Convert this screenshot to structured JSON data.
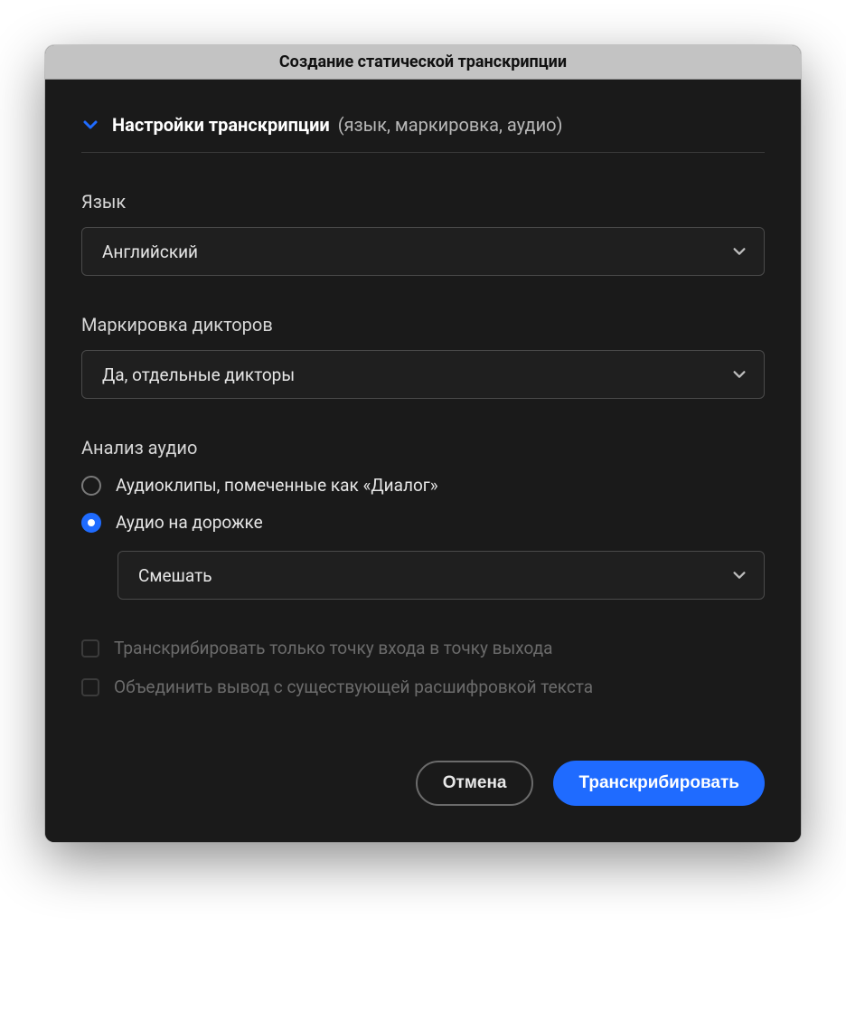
{
  "dialog": {
    "title": "Создание статической транскрипции",
    "section": {
      "title_bold": "Настройки транскрипции",
      "title_muted": "(язык, маркировка, аудио)"
    },
    "fields": {
      "language": {
        "label": "Язык",
        "value": "Английский"
      },
      "speaker_labeling": {
        "label": "Маркировка дикторов",
        "value": "Да, отдельные дикторы"
      },
      "audio_analysis": {
        "label": "Анализ аудио",
        "options": [
          {
            "label": "Аудиоклипы, помеченные как «Диалог»",
            "selected": false
          },
          {
            "label": "Аудио на дорожке",
            "selected": true
          }
        ],
        "track_select": {
          "value": "Смешать"
        }
      },
      "checkboxes": [
        {
          "label": "Транскрибировать только точку входа в точку выхода",
          "checked": false,
          "enabled": false
        },
        {
          "label": "Объединить вывод с существующей расшифровкой текста",
          "checked": false,
          "enabled": false
        }
      ]
    },
    "buttons": {
      "cancel": "Отмена",
      "transcribe": "Транскрибировать"
    }
  }
}
